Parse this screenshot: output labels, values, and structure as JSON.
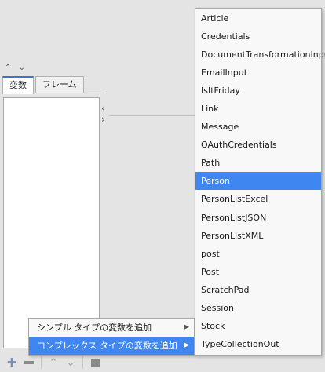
{
  "panel": {
    "collapse_arrows": "^ v",
    "tabs": [
      {
        "label": "変数",
        "active": true
      },
      {
        "label": "フレーム",
        "active": false
      }
    ]
  },
  "toolbar": {
    "add_icon": "plus-icon",
    "remove_icon": "minus-icon",
    "up_icon": "chevron-up-icon",
    "down_icon": "chevron-down-icon"
  },
  "context_menu": {
    "items": [
      {
        "label": "シンプル タイプの変数を追加",
        "selected": false
      },
      {
        "label": "コンプレックス タイプの変数を追加",
        "selected": true
      }
    ]
  },
  "submenu": {
    "items": [
      {
        "label": "Article"
      },
      {
        "label": "Credentials"
      },
      {
        "label": "DocumentTransformationInput"
      },
      {
        "label": "EmailInput"
      },
      {
        "label": "IsItFriday"
      },
      {
        "label": "Link"
      },
      {
        "label": "Message"
      },
      {
        "label": "OAuthCredentials"
      },
      {
        "label": "Path"
      },
      {
        "label": "Person",
        "selected": true
      },
      {
        "label": "PersonListExcel"
      },
      {
        "label": "PersonListJSON"
      },
      {
        "label": "PersonListXML"
      },
      {
        "label": "post"
      },
      {
        "label": "Post"
      },
      {
        "label": "ScratchPad"
      },
      {
        "label": "Session"
      },
      {
        "label": "Stock"
      },
      {
        "label": "TypeCollectionOut"
      }
    ]
  },
  "colors": {
    "selection": "#3f86f0",
    "background": "#e4e4e4"
  }
}
